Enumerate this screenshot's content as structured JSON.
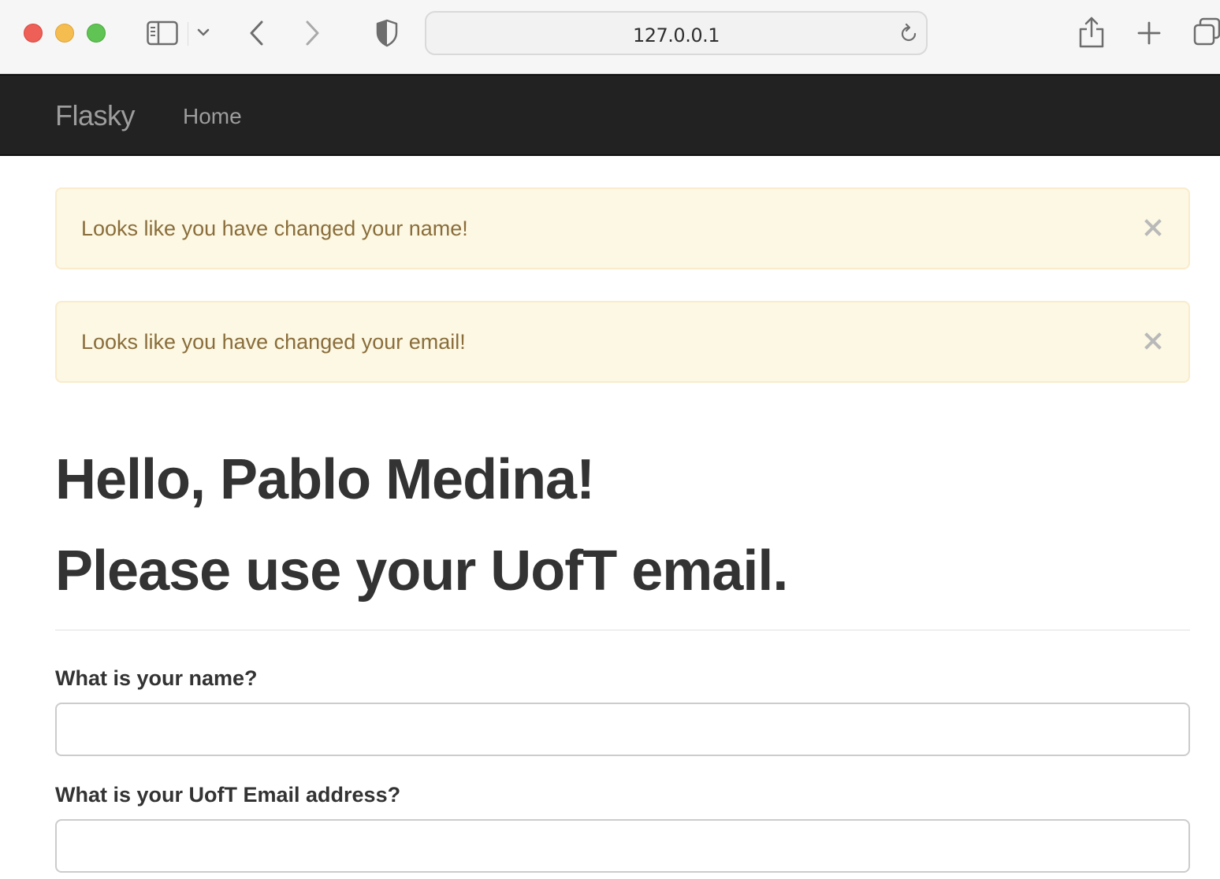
{
  "browser": {
    "url": "127.0.0.1"
  },
  "navbar": {
    "brand": "Flasky",
    "links": [
      {
        "label": "Home"
      }
    ]
  },
  "alerts": [
    {
      "message": "Looks like you have changed your name!",
      "close_label": "×"
    },
    {
      "message": "Looks like you have changed your email!",
      "close_label": "×"
    }
  ],
  "header": {
    "greeting": "Hello, Pablo Medina!",
    "subtitle": "Please use your UofT email."
  },
  "form": {
    "name_field": {
      "label": "What is your name?",
      "value": "",
      "placeholder": ""
    },
    "email_field": {
      "label": "What is your UofT Email address?",
      "value": "",
      "placeholder": ""
    }
  },
  "colors": {
    "navbar_bg": "#222222",
    "navbar_text": "#9d9d9d",
    "alert_bg": "#fcf8e3",
    "alert_border": "#faebcc",
    "alert_text": "#8a6d3b",
    "heading_text": "#333333"
  },
  "icons": {
    "sidebar": "sidebar-icon",
    "tab_overview_chevron": "chevron-down-icon",
    "back": "chevron-left-icon",
    "forward": "chevron-right-icon",
    "privacy": "shield-icon",
    "reload": "reload-icon",
    "share": "share-icon",
    "new_tab": "plus-icon",
    "tabs": "tabs-overview-icon",
    "alert_close": "close-icon"
  }
}
